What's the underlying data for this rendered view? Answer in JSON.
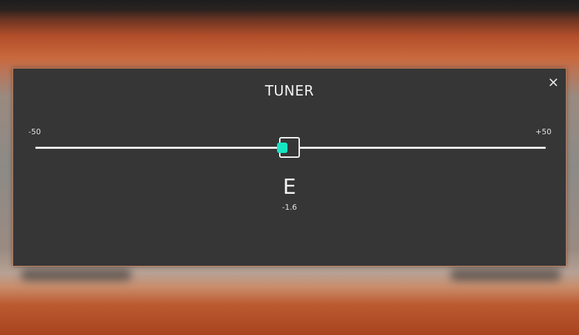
{
  "dialog": {
    "title": "TUNER",
    "close_label": "×"
  },
  "scale": {
    "min_label": "-50",
    "max_label": "+50",
    "min": -50,
    "max": 50
  },
  "reading": {
    "note": "E",
    "cents_text": "-1.6",
    "cents": -1.6
  },
  "colors": {
    "indicator": "#16e4c2",
    "panel": "#363636",
    "text": "#f2f2f2"
  },
  "icons": {
    "close": "close-icon"
  }
}
